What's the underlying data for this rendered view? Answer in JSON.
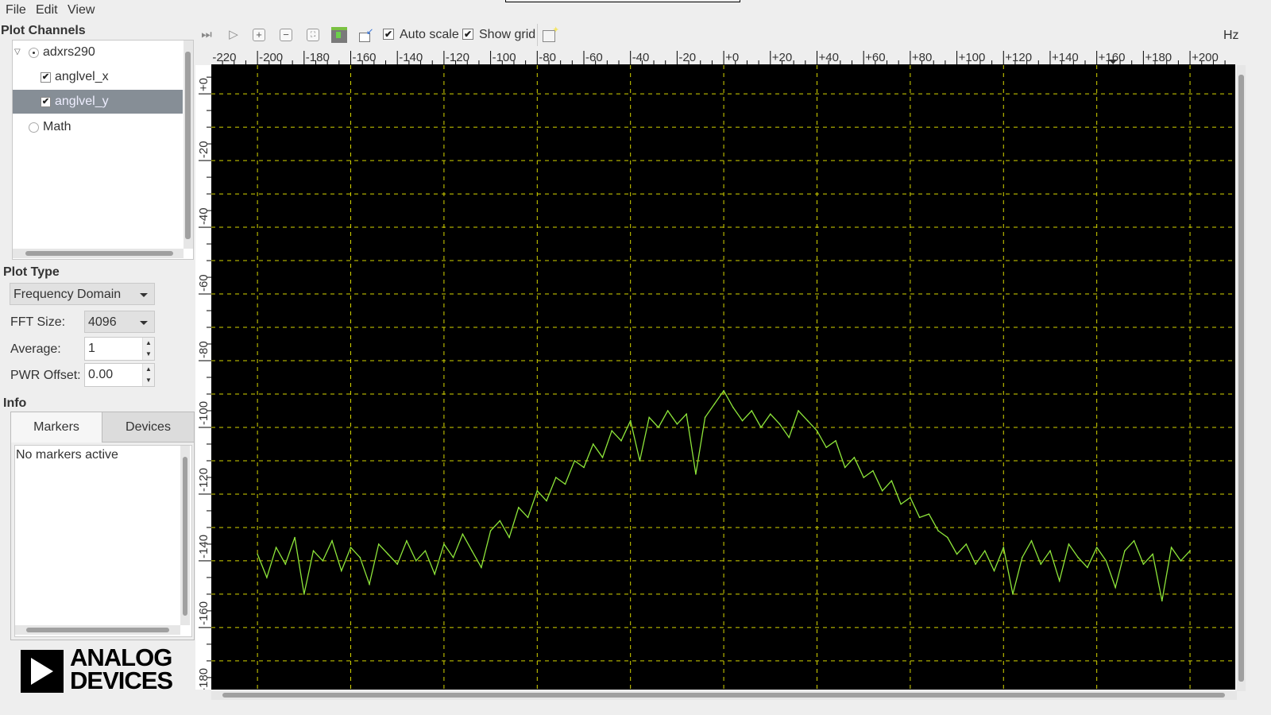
{
  "menu": {
    "file": "File",
    "edit": "Edit",
    "view": "View"
  },
  "plot_channels": {
    "title": "Plot Channels",
    "device": "adxrs290",
    "channels": [
      {
        "label": "anglvel_x",
        "checked": true,
        "selected": false
      },
      {
        "label": "anglvel_y",
        "checked": true,
        "selected": true
      }
    ],
    "math": "Math"
  },
  "plot_type": {
    "title": "Plot Type",
    "domain": "Frequency Domain",
    "fft_size_label": "FFT Size:",
    "fft_size": "4096",
    "average_label": "Average:",
    "average": "1",
    "pwr_offset_label": "PWR Offset:",
    "pwr_offset": "0.00"
  },
  "info": {
    "title": "Info",
    "tabs": [
      "Markers",
      "Devices"
    ],
    "active_tab": "Markers",
    "markers_text": "No markers active"
  },
  "logo": {
    "line1": "ANALOG",
    "line2": "DEVICES"
  },
  "toolbar": {
    "auto_scale": "Auto scale",
    "auto_scale_checked": true,
    "show_grid": "Show grid",
    "show_grid_checked": true,
    "unit": "Hz",
    "icons": [
      "fast-forward-icon",
      "play-icon",
      "zoom-in-icon",
      "zoom-out-icon",
      "zoom-fit-icon",
      "save-icon",
      "peak-marker-icon",
      "new-window-icon"
    ]
  },
  "colors": {
    "trace": "#8ee63a",
    "grid": "#d6d600",
    "background": "#000000"
  },
  "chart_data": {
    "type": "line",
    "xlabel": "Hz",
    "xlim": [
      -219.8,
      219.4
    ],
    "ylim": [
      -178.6,
      8.6
    ],
    "x_ticks": [
      "-220",
      "-200",
      "-180",
      "-160",
      "-140",
      "-120",
      "-100",
      "-80",
      "-60",
      "-40",
      "-20",
      "+0",
      "+20",
      "+40",
      "+60",
      "+80",
      "+100",
      "+120",
      "+140",
      "+160",
      "+180",
      "+200"
    ],
    "y_ticks": [
      "+0",
      "-20",
      "-40",
      "-60",
      "-80",
      "-100",
      "-120",
      "-140",
      "-160",
      "-180"
    ],
    "grid": true,
    "series": [
      {
        "x": [
          -200,
          -196,
          -192,
          -188,
          -184,
          -180,
          -176,
          -172,
          -168,
          -164,
          -160,
          -156,
          -152,
          -148,
          -144,
          -140,
          -136,
          -132,
          -128,
          -124,
          -120,
          -116,
          -112,
          -108,
          -104,
          -100,
          -96,
          -92,
          -88,
          -84,
          -80,
          -76,
          -72,
          -68,
          -64,
          -60,
          -56,
          -52,
          -48,
          -44,
          -40,
          -36,
          -32,
          -28,
          -24,
          -20,
          -16,
          -12,
          -8,
          -4,
          0,
          4,
          8,
          12,
          16,
          20,
          24,
          28,
          32,
          36,
          40,
          44,
          48,
          52,
          56,
          60,
          64,
          68,
          72,
          76,
          80,
          84,
          88,
          92,
          96,
          100,
          104,
          108,
          112,
          116,
          120,
          124,
          128,
          132,
          136,
          140,
          144,
          148,
          152,
          156,
          160,
          164,
          168,
          172,
          176,
          180,
          184,
          188,
          192,
          196,
          200
        ],
        "y": [
          -138,
          -145,
          -136,
          -141,
          -133,
          -150,
          -137,
          -140,
          -134,
          -143,
          -136,
          -139,
          -147,
          -135,
          -138,
          -141,
          -134,
          -140,
          -137,
          -144,
          -135,
          -139,
          -132,
          -137,
          -142,
          -131,
          -128,
          -133,
          -124,
          -127,
          -119,
          -122,
          -115,
          -117,
          -110,
          -112,
          -105,
          -109,
          -101,
          -104,
          -98,
          -110,
          -97,
          -100,
          -95,
          -99,
          -96,
          -114,
          -97,
          -93,
          -89,
          -94,
          -98,
          -95,
          -100,
          -96,
          -99,
          -103,
          -95,
          -98,
          -101,
          -106,
          -104,
          -112,
          -109,
          -115,
          -113,
          -119,
          -116,
          -123,
          -121,
          -127,
          -126,
          -131,
          -133,
          -138,
          -135,
          -141,
          -137,
          -143,
          -136,
          -150,
          -139,
          -134,
          -141,
          -137,
          -146,
          -135,
          -139,
          -142,
          -136,
          -140,
          -148,
          -137,
          -134,
          -141,
          -138,
          -152,
          -136,
          -140,
          -137
        ]
      }
    ]
  }
}
